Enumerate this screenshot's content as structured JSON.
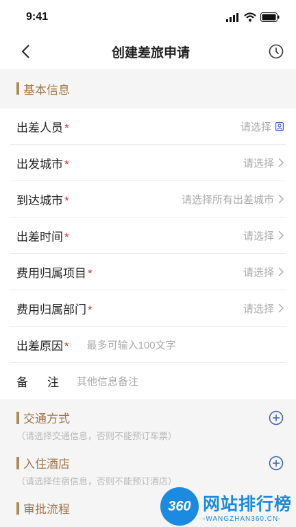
{
  "status": {
    "time": "9:41"
  },
  "nav": {
    "title": "创建差旅申请"
  },
  "basic": {
    "title": "基本信息",
    "rows": [
      {
        "label": "出差人员",
        "required": "*",
        "value": "请选择"
      },
      {
        "label": "出发城市",
        "required": "*",
        "value": "请选择"
      },
      {
        "label": "到达城市",
        "required": "*",
        "value": "请选择所有出差城市"
      },
      {
        "label": "出差时间",
        "required": "*",
        "value": "请选择"
      },
      {
        "label": "费用归属项目",
        "required": "*",
        "value": "请选择"
      },
      {
        "label": "费用归属部门",
        "required": "*",
        "value": "请选择"
      }
    ],
    "reason": {
      "label": "出差原因",
      "required": "*",
      "placeholder": "最多可输入100文字"
    },
    "remark": {
      "label": "备注",
      "placeholder": "其他信息备注"
    }
  },
  "transport": {
    "title": "交通方式",
    "hint": "（请选择交通信息，否则不能预订车票）"
  },
  "hotel": {
    "title": "入住酒店",
    "hint": "（请选择住宿信息，否则不能预订酒店）"
  },
  "approval": {
    "title": "审批流程"
  },
  "watermark": {
    "badge": "360",
    "name": "网站排行榜",
    "domain": "-WANGZHAN360.CN-"
  },
  "colors": {
    "accent": "#a0764a",
    "required": "#d32f2f",
    "add_icon": "#3c62b0",
    "watermark": "#1a8be0"
  }
}
